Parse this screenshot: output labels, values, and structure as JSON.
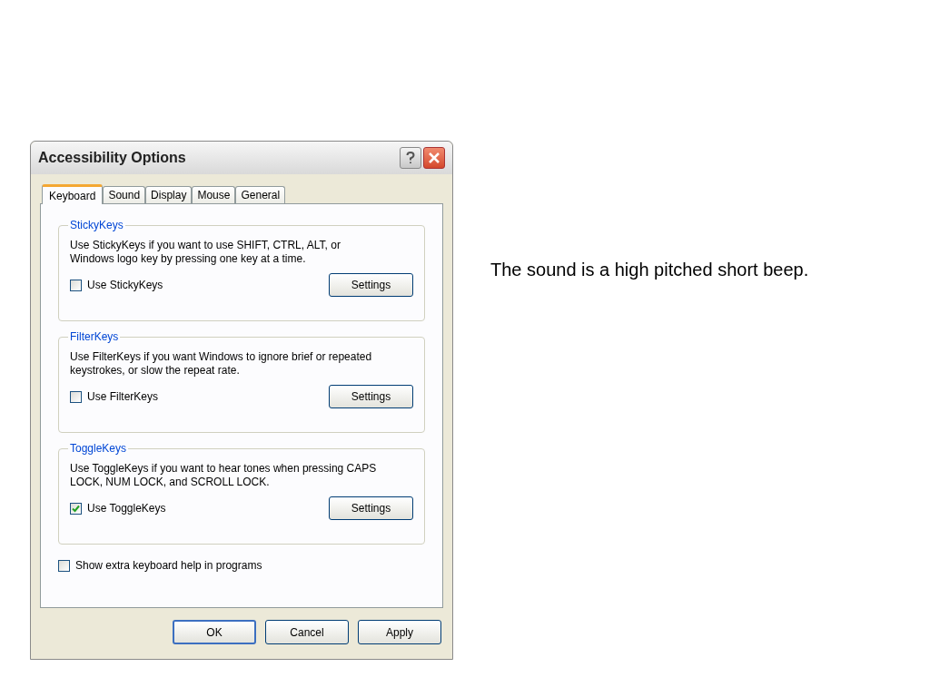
{
  "window": {
    "title": "Accessibility Options"
  },
  "tabs": [
    {
      "label": "Keyboard",
      "selected": true
    },
    {
      "label": "Sound",
      "selected": false
    },
    {
      "label": "Display",
      "selected": false
    },
    {
      "label": "Mouse",
      "selected": false
    },
    {
      "label": "General",
      "selected": false
    }
  ],
  "groups": [
    {
      "title": "StickyKeys",
      "description": "Use StickyKeys if you want to use SHIFT, CTRL, ALT, or Windows logo key by pressing one key at a time.",
      "checkbox": {
        "label": "Use StickyKeys",
        "checked": false
      },
      "button": "Settings"
    },
    {
      "title": "FilterKeys",
      "description": "Use FilterKeys if you want Windows to ignore brief or repeated keystrokes, or slow the repeat rate.",
      "checkbox": {
        "label": "Use FilterKeys",
        "checked": false
      },
      "button": "Settings"
    },
    {
      "title": "ToggleKeys",
      "description": "Use ToggleKeys if you want to hear tones when pressing CAPS LOCK, NUM LOCK, and SCROLL LOCK.",
      "checkbox": {
        "label": "Use ToggleKeys",
        "checked": true
      },
      "button": "Settings"
    }
  ],
  "extra_checkbox": {
    "label": "Show extra keyboard help in programs",
    "checked": false
  },
  "buttons": [
    {
      "label": "OK",
      "default": true
    },
    {
      "label": "Cancel",
      "default": false
    },
    {
      "label": "Apply",
      "default": false
    }
  ],
  "caption": "The sound is a high pitched short beep."
}
